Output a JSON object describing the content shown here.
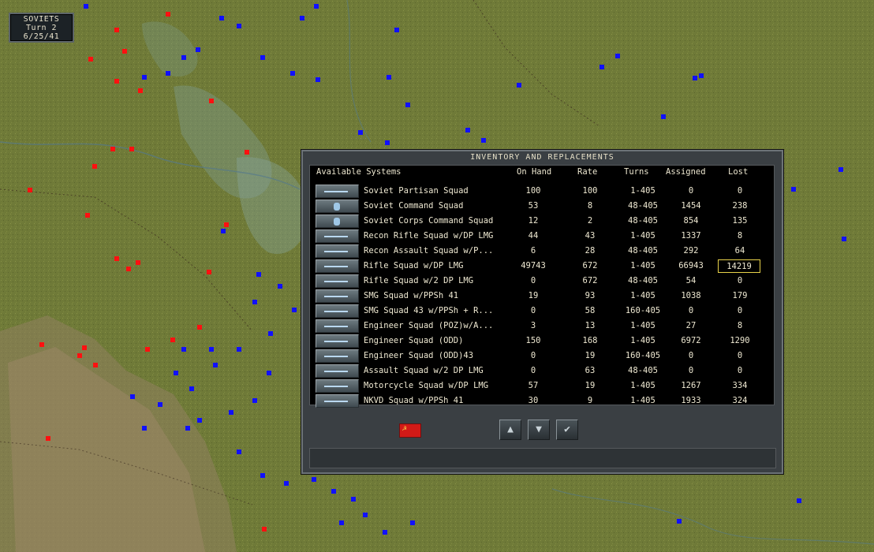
{
  "turn_panel": {
    "side": "SOVIETS",
    "turn": "Turn 2",
    "date": "6/25/41"
  },
  "dialog": {
    "title": "INVENTORY AND REPLACEMENTS",
    "headers": {
      "name": "Available Systems",
      "on_hand": "On Hand",
      "rate": "Rate",
      "turns": "Turns",
      "assigned": "Assigned",
      "lost": "Lost"
    },
    "rows": [
      {
        "name": "Soviet Partisan Squad",
        "on_hand": "100",
        "rate": "100",
        "turns": "1-405",
        "assigned": "0",
        "lost": "0",
        "icon": "rifle-icon"
      },
      {
        "name": "Soviet Command Squad",
        "on_hand": "53",
        "rate": "8",
        "turns": "48-405",
        "assigned": "1454",
        "lost": "238",
        "icon": "officer-icon"
      },
      {
        "name": "Soviet Corps Command Squad",
        "on_hand": "12",
        "rate": "2",
        "turns": "48-405",
        "assigned": "854",
        "lost": "135",
        "icon": "officer-icon"
      },
      {
        "name": "Recon Rifle Squad w/DP LMG",
        "on_hand": "44",
        "rate": "43",
        "turns": "1-405",
        "assigned": "1337",
        "lost": "8",
        "icon": "rifle-icon"
      },
      {
        "name": "Recon Assault Squad w/P...",
        "on_hand": "6",
        "rate": "28",
        "turns": "48-405",
        "assigned": "292",
        "lost": "64",
        "icon": "rifle-icon"
      },
      {
        "name": "Rifle Squad w/DP LMG",
        "on_hand": "49743",
        "rate": "672",
        "turns": "1-405",
        "assigned": "66943",
        "lost": "14219",
        "icon": "rifle-icon",
        "selected": true
      },
      {
        "name": "Rifle Squad w/2 DP LMG",
        "on_hand": "0",
        "rate": "672",
        "turns": "48-405",
        "assigned": "54",
        "lost": "0",
        "icon": "rifle-icon"
      },
      {
        "name": "SMG Squad w/PPSh 41",
        "on_hand": "19",
        "rate": "93",
        "turns": "1-405",
        "assigned": "1038",
        "lost": "179",
        "icon": "rifle-icon"
      },
      {
        "name": "SMG Squad 43 w/PPSh + R...",
        "on_hand": "0",
        "rate": "58",
        "turns": "160-405",
        "assigned": "0",
        "lost": "0",
        "icon": "rifle-icon"
      },
      {
        "name": "Engineer Squad (POZ)w/A...",
        "on_hand": "3",
        "rate": "13",
        "turns": "1-405",
        "assigned": "27",
        "lost": "8",
        "icon": "rifle-icon"
      },
      {
        "name": "Engineer Squad (ODD)",
        "on_hand": "150",
        "rate": "168",
        "turns": "1-405",
        "assigned": "6972",
        "lost": "1290",
        "icon": "rifle-icon"
      },
      {
        "name": "Engineer Squad (ODD)43",
        "on_hand": "0",
        "rate": "19",
        "turns": "160-405",
        "assigned": "0",
        "lost": "0",
        "icon": "rifle-icon"
      },
      {
        "name": "Assault Squad w/2 DP LMG",
        "on_hand": "0",
        "rate": "63",
        "turns": "48-405",
        "assigned": "0",
        "lost": "0",
        "icon": "rifle-icon"
      },
      {
        "name": "Motorcycle Squad w/DP LMG",
        "on_hand": "57",
        "rate": "19",
        "turns": "1-405",
        "assigned": "1267",
        "lost": "334",
        "icon": "rifle-icon"
      },
      {
        "name": "NKVD Squad w/PPSh 41",
        "on_hand": "30",
        "rate": "9",
        "turns": "1-405",
        "assigned": "1933",
        "lost": "324",
        "icon": "rifle-icon"
      }
    ],
    "toolbar": {
      "flag_icon": "soviet-flag-icon",
      "scroll_up_icon": "arrow-up-icon",
      "scroll_down_icon": "arrow-down-icon",
      "confirm_icon": "checkmark-icon",
      "up_glyph": "▲",
      "down_glyph": "▼",
      "ok_glyph": "✔",
      "flag_glyph": "☭"
    }
  },
  "colors": {
    "soviet_units": "#1010ff",
    "axis_units": "#ff1010",
    "terrain": "#6f7a38"
  }
}
